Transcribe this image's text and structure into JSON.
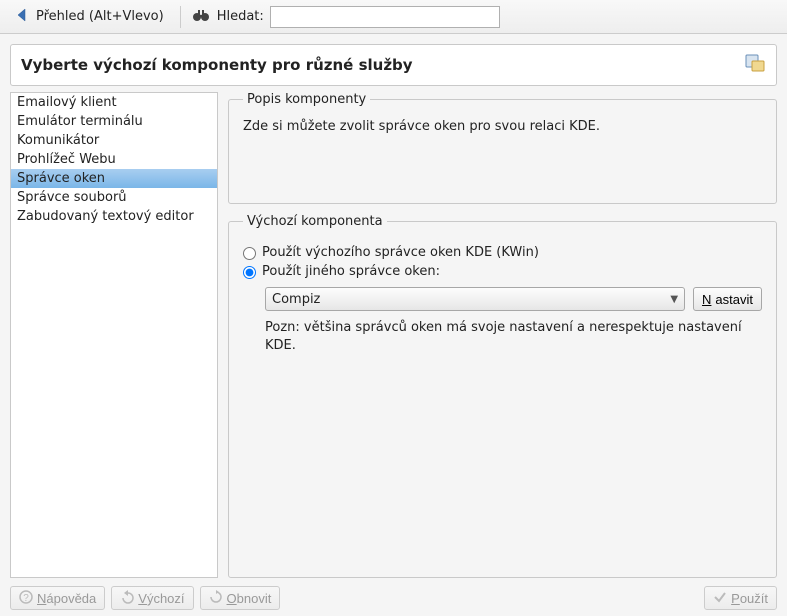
{
  "toolbar": {
    "back_label": "Přehled (Alt+Vlevo)",
    "search_label": "Hledat:",
    "search_value": ""
  },
  "title": "Vyberte výchozí komponenty pro různé služby",
  "sidebar": {
    "items": [
      {
        "label": "Emailový klient"
      },
      {
        "label": "Emulátor terminálu"
      },
      {
        "label": "Komunikátor"
      },
      {
        "label": "Prohlížeč Webu"
      },
      {
        "label": "Správce oken"
      },
      {
        "label": "Správce souborů"
      },
      {
        "label": "Zabudovaný textový editor"
      }
    ],
    "selected_index": 4
  },
  "description": {
    "legend": "Popis komponenty",
    "text": "Zde si můžete zvolit správce oken pro svou relaci KDE."
  },
  "default_component": {
    "legend": "Výchozí komponenta",
    "radio_kwin": "Použít výchozího správce oken KDE (KWin)",
    "radio_other": "Použít jiného správce oken:",
    "selected_radio": "other",
    "dropdown_value": "Compiz",
    "configure_btn_pre": "N",
    "configure_btn_rest": "astavit",
    "note": "Pozn: většina správců oken má svoje nastavení a nerespektuje nastavení KDE."
  },
  "footer": {
    "help_pre": "N",
    "help_rest": "ápověda",
    "defaults_pre": "V",
    "defaults_rest": "ýchozí",
    "reset_pre": "O",
    "reset_rest": "bnovit",
    "apply_pre": "P",
    "apply_rest": "oužít"
  }
}
